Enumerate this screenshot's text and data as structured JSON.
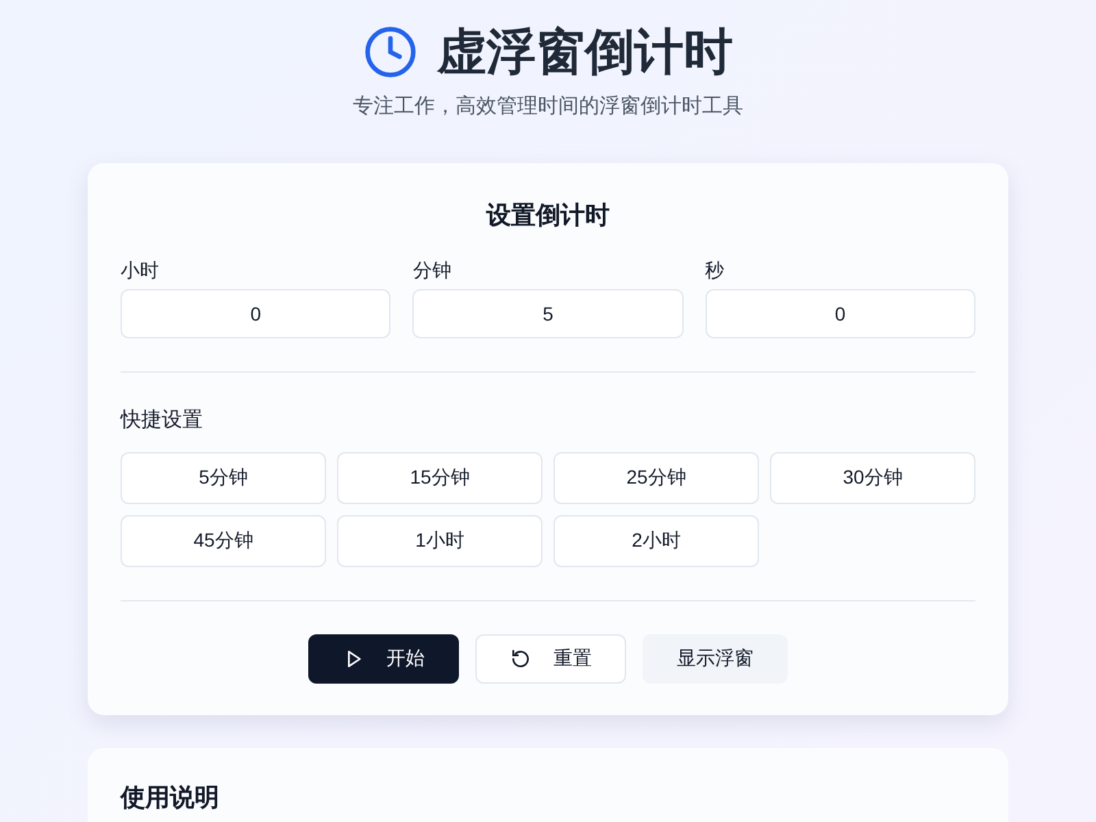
{
  "header": {
    "title": "虚浮窗倒计时",
    "subtitle": "专注工作，高效管理时间的浮窗倒计时工具"
  },
  "settings": {
    "title": "设置倒计时",
    "fields": [
      {
        "label": "小时",
        "value": "0"
      },
      {
        "label": "分钟",
        "value": "5"
      },
      {
        "label": "秒",
        "value": "0"
      }
    ],
    "presets_title": "快捷设置",
    "presets": [
      "5分钟",
      "15分钟",
      "25分钟",
      "30分钟",
      "45分钟",
      "1小时",
      "2小时"
    ],
    "actions": [
      {
        "kind": "start",
        "label": "开始"
      },
      {
        "kind": "reset",
        "label": "重置"
      },
      {
        "kind": "float",
        "label": "显示浮窗"
      }
    ]
  },
  "instructions": {
    "title": "使用说明"
  }
}
